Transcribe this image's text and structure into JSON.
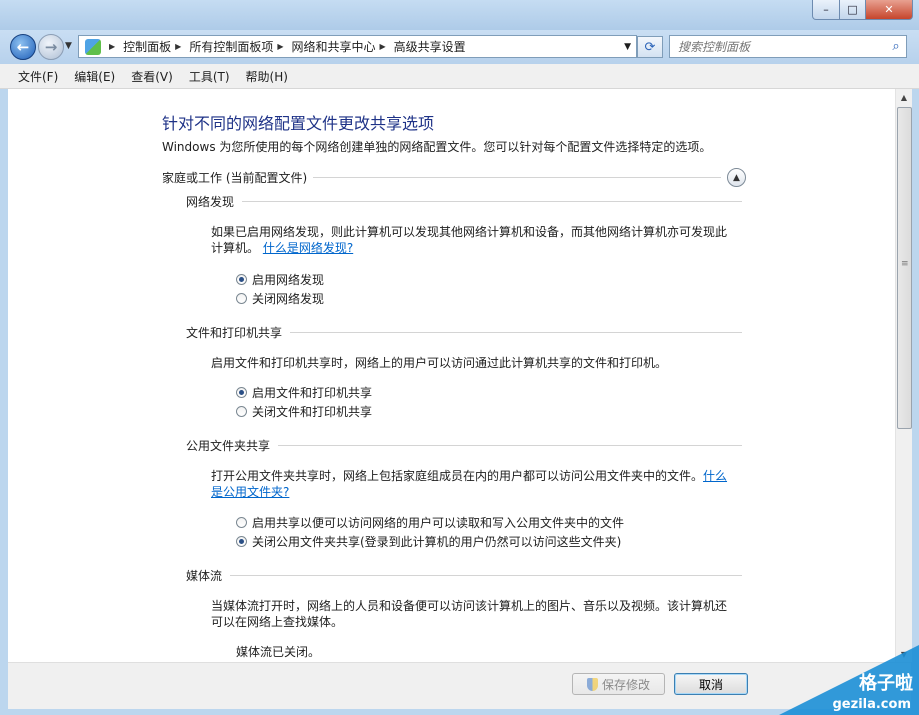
{
  "window": {
    "minimize_glyph": "–",
    "maximize_glyph": "□",
    "close_glyph": "✕"
  },
  "nav": {
    "breadcrumbs": [
      "控制面板",
      "所有控制面板项",
      "网络和共享中心",
      "高级共享设置"
    ],
    "search_placeholder": "搜索控制面板"
  },
  "menu": [
    "文件(F)",
    "编辑(E)",
    "查看(V)",
    "工具(T)",
    "帮助(H)"
  ],
  "page": {
    "title": "针对不同的网络配置文件更改共享选项",
    "subtitle": "Windows 为您所使用的每个网络创建单独的网络配置文件。您可以针对每个配置文件选择特定的选项。",
    "profile_header": "家庭或工作 (当前配置文件)"
  },
  "sections": {
    "discovery": {
      "title": "网络发现",
      "desc_line1": "如果已启用网络发现，则此计算机可以发现其他网络计算机和设备，而其他网络计算机亦可发现此",
      "desc_line2": "计算机。",
      "link": "什么是网络发现?",
      "options": [
        "启用网络发现",
        "关闭网络发现"
      ],
      "selected": 0
    },
    "fileprint": {
      "title": "文件和打印机共享",
      "desc": "启用文件和打印机共享时，网络上的用户可以访问通过此计算机共享的文件和打印机。",
      "options": [
        "启用文件和打印机共享",
        "关闭文件和打印机共享"
      ],
      "selected": 0
    },
    "public": {
      "title": "公用文件夹共享",
      "desc_line1": "打开公用文件夹共享时，网络上包括家庭组成员在内的用户都可以访问公用文件夹中的文件。",
      "link_part1": "什么",
      "link_part2": "是公用文件夹?",
      "options": [
        "启用共享以便可以访问网络的用户可以读取和写入公用文件夹中的文件",
        "关闭公用文件夹共享(登录到此计算机的用户仍然可以访问这些文件夹)"
      ],
      "selected": 1
    },
    "media": {
      "title": "媒体流",
      "desc_line1": "当媒体流打开时，网络上的人员和设备便可以访问该计算机上的图片、音乐以及视频。该计算机还",
      "desc_line2": "可以在网络上查找媒体。",
      "status": "媒体流已关闭。"
    }
  },
  "buttons": {
    "save": "保存修改",
    "cancel": "取消"
  },
  "watermark": {
    "line1": "格子啦",
    "line2": "gezila.com"
  }
}
